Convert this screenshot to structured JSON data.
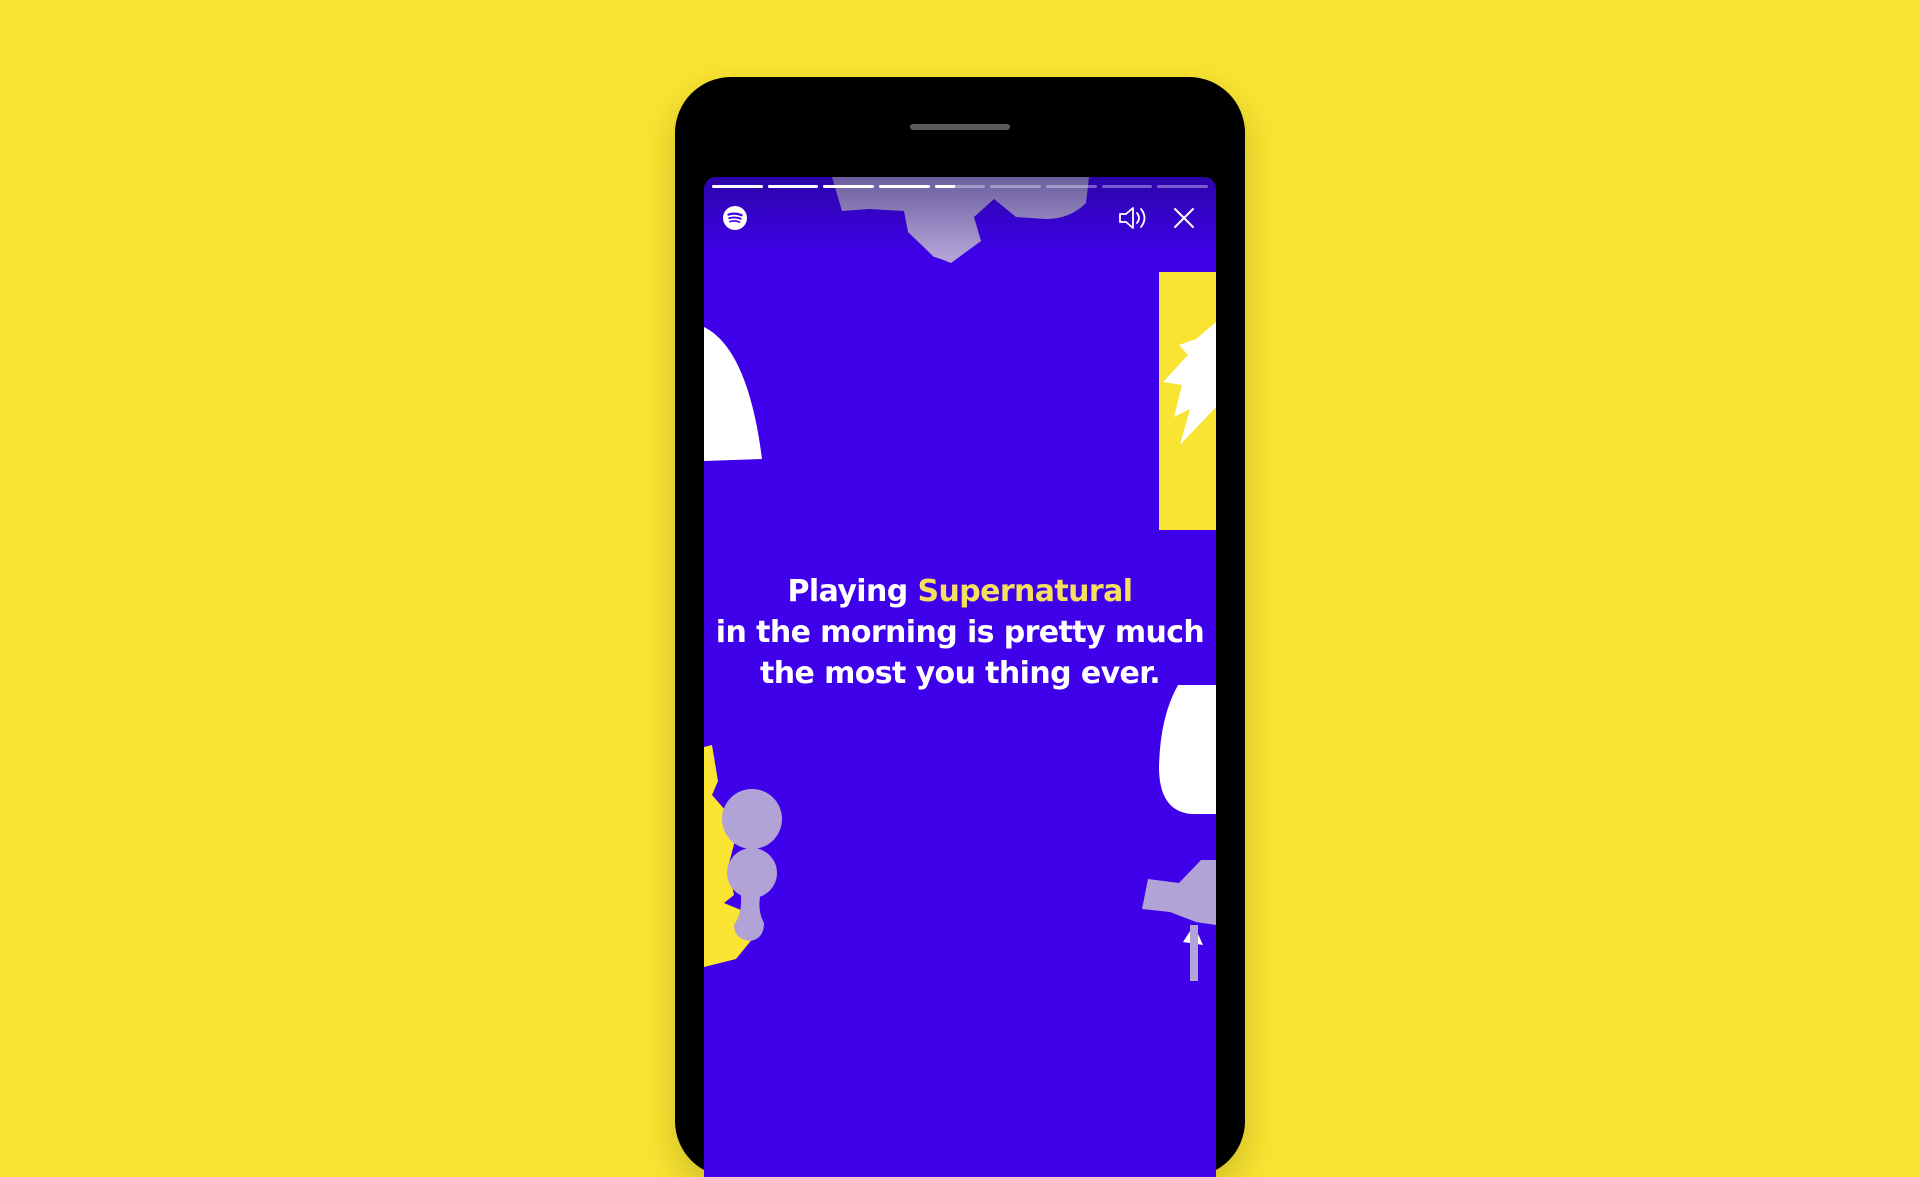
{
  "colors": {
    "background": "#F9E431",
    "phone": "#000000",
    "screen": "#3F01EA",
    "highlight": "#F6DE5E",
    "text": "#FFFFFF",
    "shape_lavender": "#B2A3D6",
    "shape_white": "#FFFFFF",
    "shape_yellow": "#F9E431"
  },
  "story": {
    "segments_total": 9,
    "segments_completed": 4,
    "current_segment_progress": 0.4,
    "line1_prefix": "Playing ",
    "line1_highlight": "Supernatural",
    "line2": "in the morning is pretty much",
    "line3": "the most you thing ever."
  },
  "icons": {
    "logo": "spotify-logo-icon",
    "sound": "speaker-volume-icon",
    "close": "close-icon"
  }
}
